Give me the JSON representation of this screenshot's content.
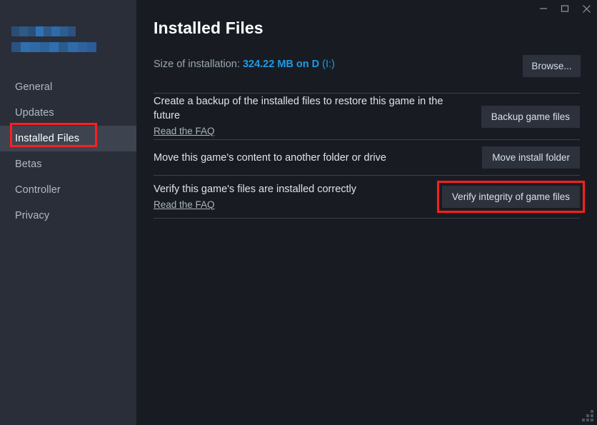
{
  "window": {
    "controls": [
      {
        "name": "minimize",
        "glyph": "minimize-icon"
      },
      {
        "name": "maximize",
        "glyph": "maximize-icon"
      },
      {
        "name": "close",
        "glyph": "close-icon"
      }
    ]
  },
  "sidebar": {
    "redacted_title": {
      "line1_colors": [
        "#2b4d74",
        "#2e5a85",
        "#2a4f79",
        "#2f72b5",
        "#2d5a8a",
        "#2e6ba8",
        "#2c5e93",
        "#2a5282"
      ],
      "line2_colors": [
        "#2b5280",
        "#2f6fae",
        "#2e6aa6",
        "#2d639c",
        "#2f6fb0",
        "#2a5b8d",
        "#2e6bab",
        "#2c62a0",
        "#2b5c95"
      ]
    },
    "items": [
      {
        "label": "General",
        "active": false
      },
      {
        "label": "Updates",
        "active": false
      },
      {
        "label": "Installed Files",
        "active": true
      },
      {
        "label": "Betas",
        "active": false
      },
      {
        "label": "Controller",
        "active": false
      },
      {
        "label": "Privacy",
        "active": false
      }
    ],
    "highlight_color": "#ff1f1f"
  },
  "main": {
    "title": "Installed Files",
    "size_label": "Size of installation:",
    "size_value": "324.22 MB on D",
    "size_drive": "(I:)",
    "browse_button": "Browse...",
    "rows": [
      {
        "description": "Create a backup of the installed files to restore this game in the future",
        "link": "Read the FAQ",
        "button": "Backup game files",
        "highlighted": false
      },
      {
        "description": "Move this game's content to another folder or drive",
        "link": "",
        "button": "Move install folder",
        "highlighted": false
      },
      {
        "description": "Verify this game's files are installed correctly",
        "link": "Read the FAQ",
        "button": "Verify integrity of game files",
        "highlighted": true
      }
    ]
  },
  "colors": {
    "accent_blue": "#1e9ae8",
    "annotation_red": "#ff1f1f",
    "sidebar_bg": "#2a2e38",
    "content_bg": "#181c22",
    "button_bg": "#2c313b",
    "active_nav_bg": "#3d4450"
  }
}
